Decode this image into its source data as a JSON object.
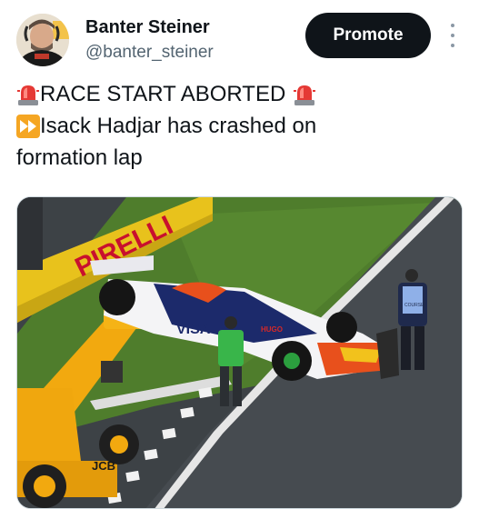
{
  "author": {
    "display_name": "Banter Steiner",
    "handle": "@banter_steiner",
    "avatar_icon": "profile-photo"
  },
  "actions": {
    "promote_label": "Promote",
    "more_icon": "more-vertical-icon"
  },
  "tweet": {
    "line1": "RACE START ABORTED",
    "line2": "Isack Hadjar has crashed on",
    "line3": "formation lap",
    "emoji_siren": "police-car-light-emoji",
    "emoji_fast_forward": "fast-forward-emoji"
  },
  "media": {
    "image_text": {
      "sponsor_car": "VISA",
      "barrier_brand": "PIRELLI",
      "car_logo": "HUGO",
      "marshal_vest": "COURSE",
      "digger_brand": "JCB"
    }
  },
  "colors": {
    "promote_bg": "#0f1419",
    "handle": "#536471",
    "siren": "#e53935",
    "fast_forward": "#f5a623"
  }
}
